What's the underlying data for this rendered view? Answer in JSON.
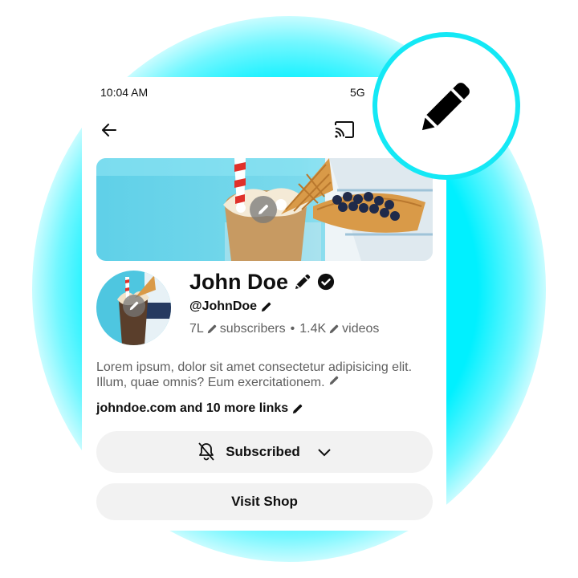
{
  "colors": {
    "glow": "#00f0ff",
    "zoom_ring": "#14e8f5",
    "button_bg": "#f2f2f2",
    "text_primary": "#0f0f0f",
    "text_secondary": "#606060"
  },
  "status_bar": {
    "time": "10:04 AM",
    "network": "5G"
  },
  "top_bar": {
    "back_icon": "arrow-left-icon",
    "cast_icon": "cast-icon"
  },
  "banner": {
    "image": "milkshake-with-waffle-cone-and-blueberries",
    "edit_icon": "pencil-icon"
  },
  "avatar": {
    "image": "milkshake-with-waffle-cone",
    "edit_icon": "pencil-icon"
  },
  "channel": {
    "name": "John Doe",
    "verified_icon": "verified-check-icon",
    "handle": "@JohnDoe",
    "subscribers_count": "7L",
    "subscribers_label": "subscribers",
    "separator": "•",
    "videos_count": "1.4K",
    "videos_label": "videos"
  },
  "description": {
    "text": "Lorem ipsum, dolor sit amet consectetur adipisicing elit. Illum, quae omnis? Eum exercitationem."
  },
  "links": {
    "text": "johndoe.com and 10 more links"
  },
  "actions": {
    "subscribed_label": "Subscribed",
    "bell_icon": "bell-off-icon",
    "chevron_icon": "chevron-down-icon",
    "shop_label": "Visit Shop"
  },
  "zoom_callout": {
    "icon": "pencil-icon"
  }
}
